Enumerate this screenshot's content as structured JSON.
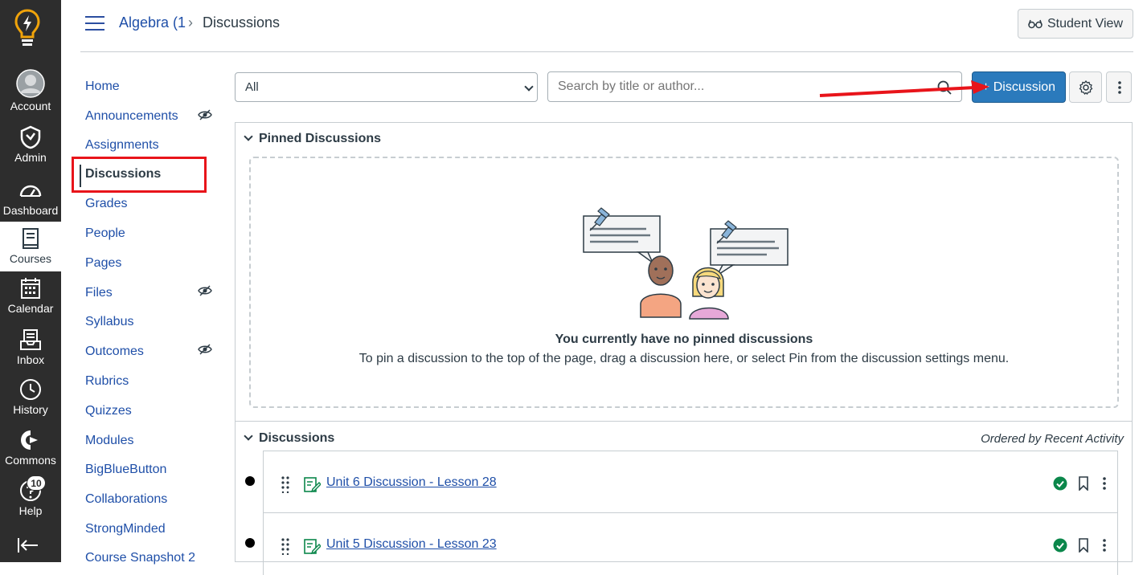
{
  "global_nav": {
    "items": [
      {
        "label": "Account",
        "icon": "avatar-icon"
      },
      {
        "label": "Admin",
        "icon": "shield-icon"
      },
      {
        "label": "Dashboard",
        "icon": "dashboard-icon"
      },
      {
        "label": "Courses",
        "icon": "courses-icon"
      },
      {
        "label": "Calendar",
        "icon": "calendar-icon"
      },
      {
        "label": "Inbox",
        "icon": "inbox-icon"
      },
      {
        "label": "History",
        "icon": "clock-icon"
      },
      {
        "label": "Commons",
        "icon": "commons-icon"
      },
      {
        "label": "Help",
        "icon": "help-icon"
      }
    ],
    "help_badge": "10",
    "active": "Courses"
  },
  "header": {
    "course": "Algebra (1",
    "separator": "›",
    "page": "Discussions",
    "student_view": "Student View"
  },
  "course_nav": {
    "items": [
      {
        "label": "Home"
      },
      {
        "label": "Announcements",
        "hidden": true
      },
      {
        "label": "Assignments"
      },
      {
        "label": "Discussions",
        "active": true
      },
      {
        "label": "Grades"
      },
      {
        "label": "People"
      },
      {
        "label": "Pages"
      },
      {
        "label": "Files",
        "hidden": true
      },
      {
        "label": "Syllabus"
      },
      {
        "label": "Outcomes",
        "hidden": true
      },
      {
        "label": "Rubrics"
      },
      {
        "label": "Quizzes"
      },
      {
        "label": "Modules"
      },
      {
        "label": "BigBlueButton"
      },
      {
        "label": "Collaborations"
      },
      {
        "label": "StrongMinded"
      },
      {
        "label": "Course Snapshot 2"
      }
    ]
  },
  "toolbar": {
    "filter_value": "All",
    "search_placeholder": "Search by title or author...",
    "add_button": "+ Discussion"
  },
  "pinned": {
    "title": "Pinned Discussions",
    "empty_title": "You currently have no pinned discussions",
    "empty_desc": "To pin a discussion to the top of the page, drag a discussion here, or select Pin from the discussion settings menu."
  },
  "discussions": {
    "title": "Discussions",
    "order_label": "Ordered by Recent Activity",
    "rows": [
      {
        "title": "Unit 6 Discussion - Lesson 28"
      },
      {
        "title": "Unit 5 Discussion - Lesson 23"
      }
    ]
  },
  "colors": {
    "nav_bg": "#2d2d2d",
    "link": "#1f4fa8",
    "primary_button": "#2b7abc",
    "annotation_red": "#e8141a",
    "published_green": "#0b874b"
  }
}
